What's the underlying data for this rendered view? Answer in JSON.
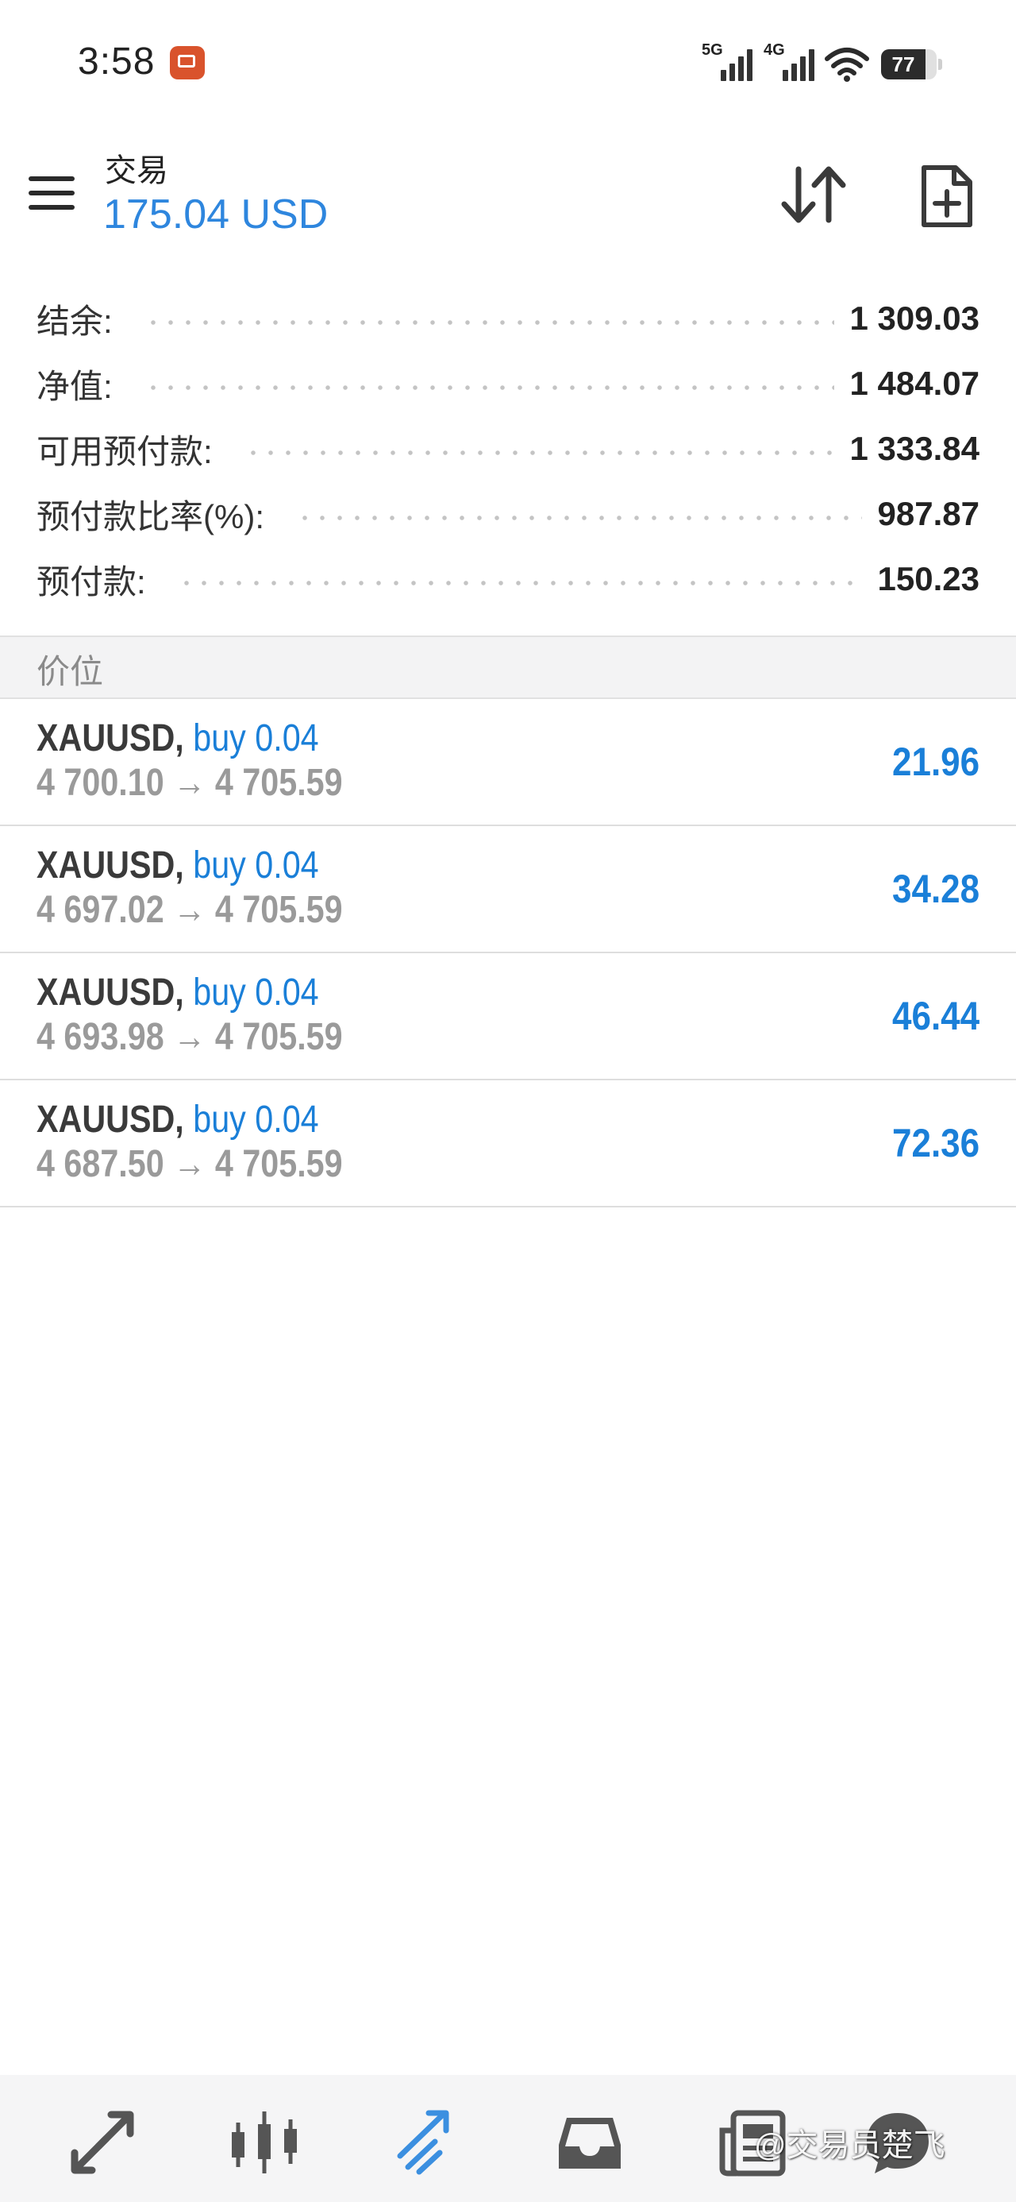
{
  "status_bar": {
    "time": "3:58",
    "network_1": "5G",
    "network_2": "4G",
    "battery_level": "77"
  },
  "header": {
    "title": "交易",
    "profit": "175.04 USD"
  },
  "account_summary": [
    {
      "label": "结余:",
      "value": "1 309.03"
    },
    {
      "label": "净值:",
      "value": "1 484.07"
    },
    {
      "label": "可用预付款:",
      "value": "1 333.84"
    },
    {
      "label": "预付款比率(%):",
      "value": "987.87"
    },
    {
      "label": "预付款:",
      "value": "150.23"
    }
  ],
  "positions_section": {
    "title": "价位"
  },
  "positions": [
    {
      "symbol": "XAUUSD,",
      "side": "buy 0.04",
      "prices": "4 700.10 → 4 705.59",
      "profit": "21.96"
    },
    {
      "symbol": "XAUUSD,",
      "side": "buy 0.04",
      "prices": "4 697.02 → 4 705.59",
      "profit": "34.28"
    },
    {
      "symbol": "XAUUSD,",
      "side": "buy 0.04",
      "prices": "4 693.98 → 4 705.59",
      "profit": "46.44"
    },
    {
      "symbol": "XAUUSD,",
      "side": "buy 0.04",
      "prices": "4 687.50 → 4 705.59",
      "profit": "72.36"
    }
  ],
  "bottom_nav": {
    "items": [
      {
        "icon": "quotes-icon"
      },
      {
        "icon": "chart-icon"
      },
      {
        "icon": "trade-icon",
        "active": true
      },
      {
        "icon": "history-icon"
      },
      {
        "icon": "news-icon"
      },
      {
        "icon": "chat-icon"
      }
    ]
  },
  "watermark": "@交易员楚飞",
  "colors": {
    "accent": "#1a7fd8",
    "header_profit": "#2e86de",
    "text": "#333333",
    "muted": "#9a9a9a"
  }
}
